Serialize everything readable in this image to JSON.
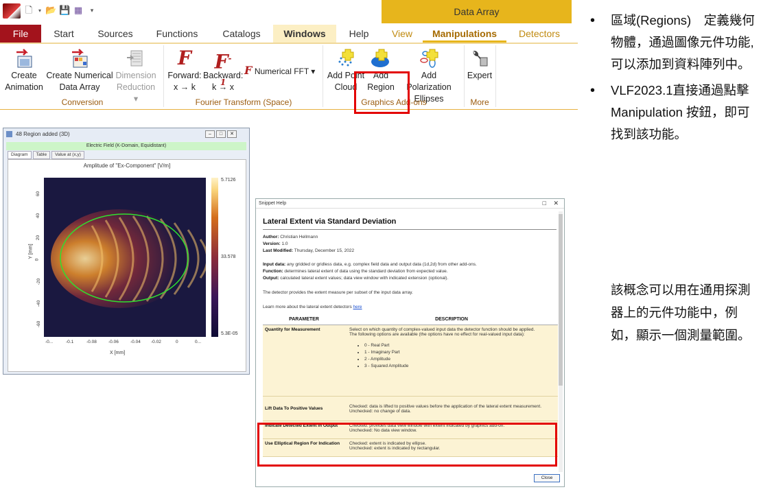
{
  "qat": {
    "icons": [
      "app-logo-icon",
      "new-file-icon",
      "dropdown-icon",
      "open-folder-icon",
      "save-icon",
      "save-all-icon",
      "customize-icon"
    ]
  },
  "context_band": "Data Array",
  "tabs": [
    {
      "label": "File"
    },
    {
      "label": "Start"
    },
    {
      "label": "Sources"
    },
    {
      "label": "Functions"
    },
    {
      "label": "Catalogs"
    },
    {
      "label": "Windows"
    },
    {
      "label": "Help"
    },
    {
      "label": "View"
    },
    {
      "label": "Manipulations"
    },
    {
      "label": "Detectors"
    }
  ],
  "groups": {
    "conversion": {
      "label": "Conversion",
      "create_animation": [
        "Create",
        "Animation"
      ],
      "create_numerical": [
        "Create Numerical",
        "Data Array"
      ],
      "dimension_reduction": [
        "Dimension",
        "Reduction ▾"
      ]
    },
    "fourier": {
      "label": "Fourier Transform (Space)",
      "forward": [
        "Forward:",
        "x → k"
      ],
      "backward": [
        "Backward:",
        "k → x"
      ],
      "numerical_fft": "Numerical FFT ▾"
    },
    "graphics_addons": {
      "label": "Graphics Add-ons",
      "add_point_cloud": [
        "Add Point",
        "Cloud"
      ],
      "add_region": [
        "Add",
        "Region"
      ],
      "add_polarization": [
        "Add Polarization",
        "Ellipses"
      ]
    },
    "more": {
      "label": "More",
      "expert": [
        "Expert"
      ]
    }
  },
  "bullets": [
    "區域(Regions)　定義幾何物體，通過圖像元件功能, 可以添加到資料陣列中。",
    "VLF2023.1直接通過點擊Manipulation 按鈕，即可找到該功能。"
  ],
  "note": "該概念可以用在通用探測器上的元件功能中，例如，顯示一個測量範圍。",
  "data_window": {
    "title": "48 Region added (3D)",
    "subtitle": "Electric Field (K-Domain, Equidistant)",
    "tabs": [
      "Diagram",
      "Table",
      "Value at (x,y)"
    ],
    "plot_title": "Amplitude of \"Ex-Component\" [V/m]",
    "colorbar_max": "5.7126",
    "colorbar_mid": "33.578",
    "colorbar_min": "5.3E-05",
    "x_ticks": [
      "-0...",
      "-0.1",
      "-0.08",
      "-0.06",
      "-0.04",
      "-0.02",
      "0",
      "0..."
    ],
    "y_ticks": [
      "60",
      "40",
      "20",
      "0",
      "-20",
      "-40",
      "-60"
    ],
    "xlabel": "X [mm]",
    "ylabel": "Y [mm]"
  },
  "help_window": {
    "titlebar": "Snippet Help",
    "title": "Lateral Extent via Standard Deviation",
    "meta": [
      {
        "key": "Author:",
        "val": "Christian Hellmann"
      },
      {
        "key": "Version:",
        "val": "1.0"
      },
      {
        "key": "Last Modified:",
        "val": "Thursday, December 15, 2022"
      }
    ],
    "io": [
      {
        "key": "Input data:",
        "val": "any gridded or gridless data, e.g. complex field data and output data (1d,2d) from other add-ons."
      },
      {
        "key": "Function:",
        "val": "determines lateral extent of data using the standard deviation from expected value."
      },
      {
        "key": "Output:",
        "val": "calculated lateral extent values; data view window with indicated extension (optional)."
      }
    ],
    "desc": "The detector provides the extent measure per subset of the input data array.",
    "learn_prefix": "Learn more about the lateral extent detectors ",
    "learn_link": "here",
    "table_headers": [
      "PARAMETER",
      "DESCRIPTION"
    ],
    "rows": [
      {
        "param": "Quantity for Measurement",
        "desc": "Select on which quantity of complex-valued input data the detector function should be applied.",
        "desc2": "The following options are available (the options have no effect for real-valued input data):",
        "items": [
          "0 - Real Part",
          "1 - Imaginary Part",
          "2 - Amplitude",
          "3 - Squared Amplitude"
        ]
      },
      {
        "param": "Lift Data To Positive Values",
        "desc": "Checked: data is lifted to positive values before the application of the lateral extent measurement.",
        "desc2": "Unchecked: no change of data."
      },
      {
        "param": "Indicate Detected Extent in Output",
        "desc": "Checked: provides data view window with extent indicated by graphics add-on.",
        "desc2": "Unchecked: No data view window."
      },
      {
        "param": "Use Elliptical Region For Indication",
        "desc": "Checked: extent is indicated by ellipse.",
        "desc2": "Unchecked: extent is indicated by rectangular."
      }
    ],
    "close_label": "Close"
  },
  "colors": {
    "file_tab": "#a3131c",
    "context": "#e7b51c",
    "highlight": "#e30000",
    "ellipse": "#2fe02f"
  }
}
